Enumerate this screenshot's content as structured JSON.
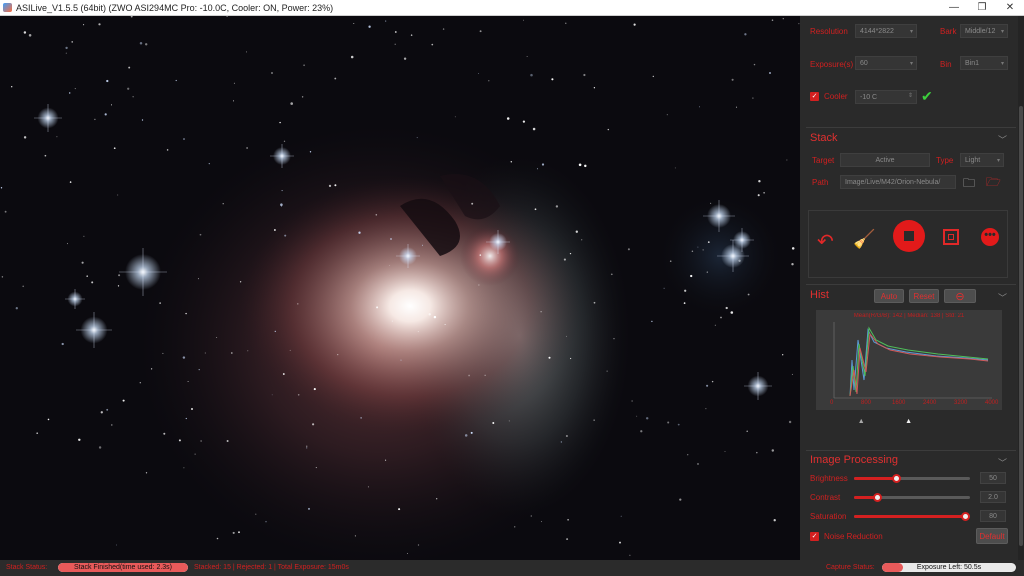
{
  "window": {
    "title": "ASILive_V1.5.5 (64bit)   (ZWO ASI294MC Pro: -10.0C, Cooler: ON, Power: 23%)",
    "minimize": "—",
    "restore": "❐",
    "close": "✕"
  },
  "camera": {
    "resolution_label": "Resolution",
    "resolution_value": "4144*2822",
    "bit_label": "Bark",
    "bit_value": "Middle/12",
    "exposure_label": "Exposure(s)",
    "exposure_value": "60",
    "bin_label": "Bin",
    "bin_value": "Bin1",
    "cooler_label": "Cooler",
    "cooler_value": "-10 C",
    "cooler_checked": true
  },
  "stack": {
    "header": "Stack",
    "target_label": "Target",
    "target_value": "Active",
    "type_label": "Type",
    "type_value": "Light",
    "path_label": "Path",
    "path_value": "Image/Live/M42/Orion-Nebula/"
  },
  "hist": {
    "header": "Hist",
    "auto_label": "Auto",
    "reset_label": "Reset",
    "info": "Mean(R/G/B): 142 | Median: 138 | Std: 21",
    "ticks": [
      "0",
      "800",
      "1600",
      "2400",
      "3200",
      "4000"
    ],
    "low_marker": 0.15,
    "high_marker": 0.45
  },
  "image_processing": {
    "header": "Image Processing",
    "brightness_label": "Brightness",
    "brightness_value": "50",
    "brightness_level": 0.36,
    "contrast_label": "Contrast",
    "contrast_value": "2.0",
    "contrast_level": 0.2,
    "saturation_label": "Saturation",
    "saturation_value": "80",
    "saturation_level": 0.96,
    "noise_label": "Noise Reduction",
    "noise_checked": true,
    "default_label": "Default"
  },
  "status": {
    "stack_status_label": "Stack Status:",
    "stack_progress_text": "Stack Finished(time used: 2.3s)",
    "stack_progress": 1.0,
    "stack_info": "Stacked: 15 | Rejected: 1 | Total Exposure: 15m0s",
    "capture_status_label": "Capture Status:",
    "exposure_left_text": "Exposure Left: 50.5s",
    "exposure_progress": 0.16
  },
  "colors": {
    "accent": "#d42020",
    "panel_bg": "#2a2a2a",
    "viewer_bg": "#0a0a0e"
  }
}
